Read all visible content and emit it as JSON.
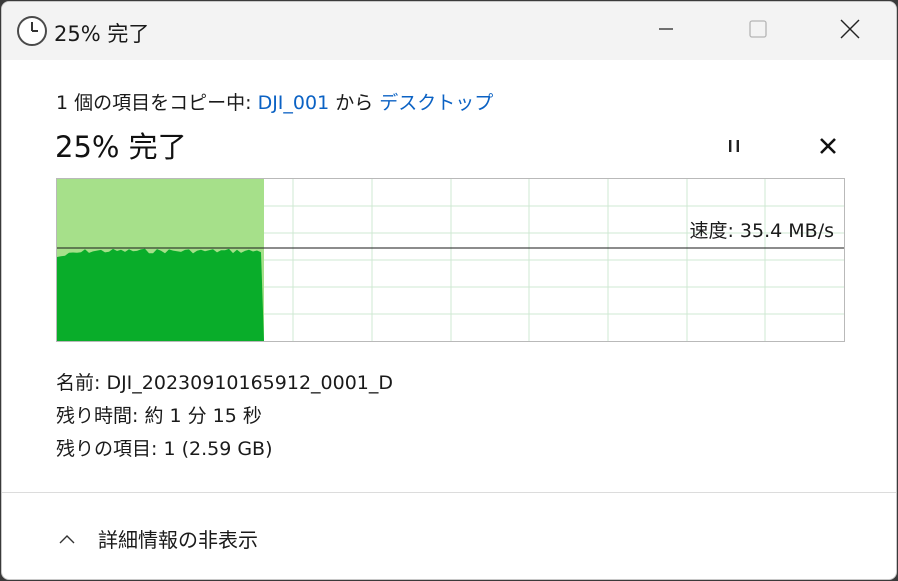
{
  "window": {
    "title": "25% 完了",
    "icons": {
      "app": "clock-icon",
      "minimize": "minimize-icon",
      "maximize": "maximize-icon",
      "close": "close-icon"
    }
  },
  "copy": {
    "prefix": "1 個の項目をコピー中: ",
    "source": "DJI_001",
    "middle": " から ",
    "destination": "デスクトップ"
  },
  "progress": {
    "label": "25% 完了",
    "fraction": 0.25
  },
  "controls": {
    "pause_icon": "pause-icon",
    "cancel_icon": "cancel-icon"
  },
  "graph": {
    "speed_label": "速度: 35.4 MB/s",
    "fill_colors": {
      "completed": "#a6e08a",
      "throughput": "#09ad2a",
      "grid": "#cfe8d3",
      "speed_line": "#1a1a1a"
    }
  },
  "details": {
    "name_label": "名前: ",
    "name_value": "DJI_20230910165912_0001_D",
    "time_label": "残り時間: ",
    "time_value": "約 1 分 15 秒",
    "items_label": "残りの項目: ",
    "items_value": "1 (2.59 GB)"
  },
  "footer": {
    "toggle_label": "詳細情報の非表示",
    "toggle_icon": "chevron-up-icon"
  }
}
